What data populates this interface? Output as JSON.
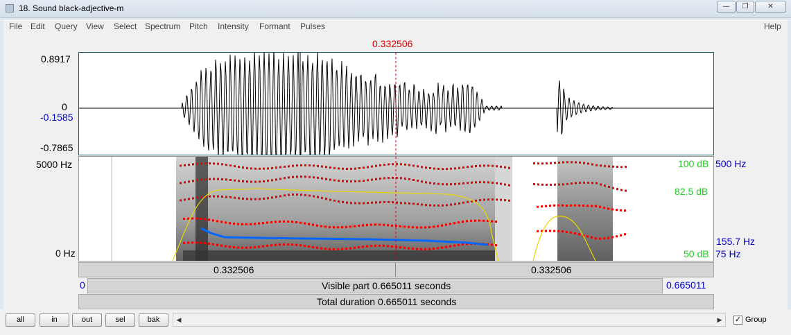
{
  "window": {
    "title": "18. Sound black-adjective-m",
    "minimize_glyph": "—",
    "maximize_glyph": "❐",
    "close_glyph": "✕"
  },
  "menu": {
    "items": [
      "File",
      "Edit",
      "Query",
      "View",
      "Select",
      "Spectrum",
      "Pitch",
      "Intensity",
      "Formant",
      "Pulses"
    ],
    "help": "Help"
  },
  "cursor_time": "0.332506",
  "waveform": {
    "y_max": "0.8917",
    "y_zero": "0",
    "y_cursor": "-0.1585",
    "y_min": "-0.7865"
  },
  "spectrogram": {
    "freq_top": "5000 Hz",
    "freq_bottom": "0 Hz",
    "intensity_top": "100 dB",
    "intensity_mid": "82.5 dB",
    "intensity_bottom": "50 dB",
    "pitch_top": "500 Hz",
    "pitch_cursor": "155.7 Hz",
    "pitch_bottom": "75 Hz"
  },
  "selection_bar": {
    "left_value": "0.332506",
    "right_value": "0.332506"
  },
  "visible_bar": {
    "start": "0",
    "label": "Visible part 0.665011 seconds",
    "end": "0.665011"
  },
  "total_bar": {
    "label": "Total duration 0.665011 seconds"
  },
  "toolbar": {
    "all": "all",
    "in": "in",
    "out": "out",
    "sel": "sel",
    "bak": "bak",
    "group_label": "Group",
    "group_checked": true,
    "scroll_left": "◀",
    "scroll_right": "▶"
  },
  "colors": {
    "cursor": "#ff0000",
    "blue_text": "#0000cc",
    "intensity_green": "#00cc00",
    "pitch_blue": "#0066ff",
    "intensity_curve": "#e8d800",
    "formant_red": "#ee0000"
  }
}
